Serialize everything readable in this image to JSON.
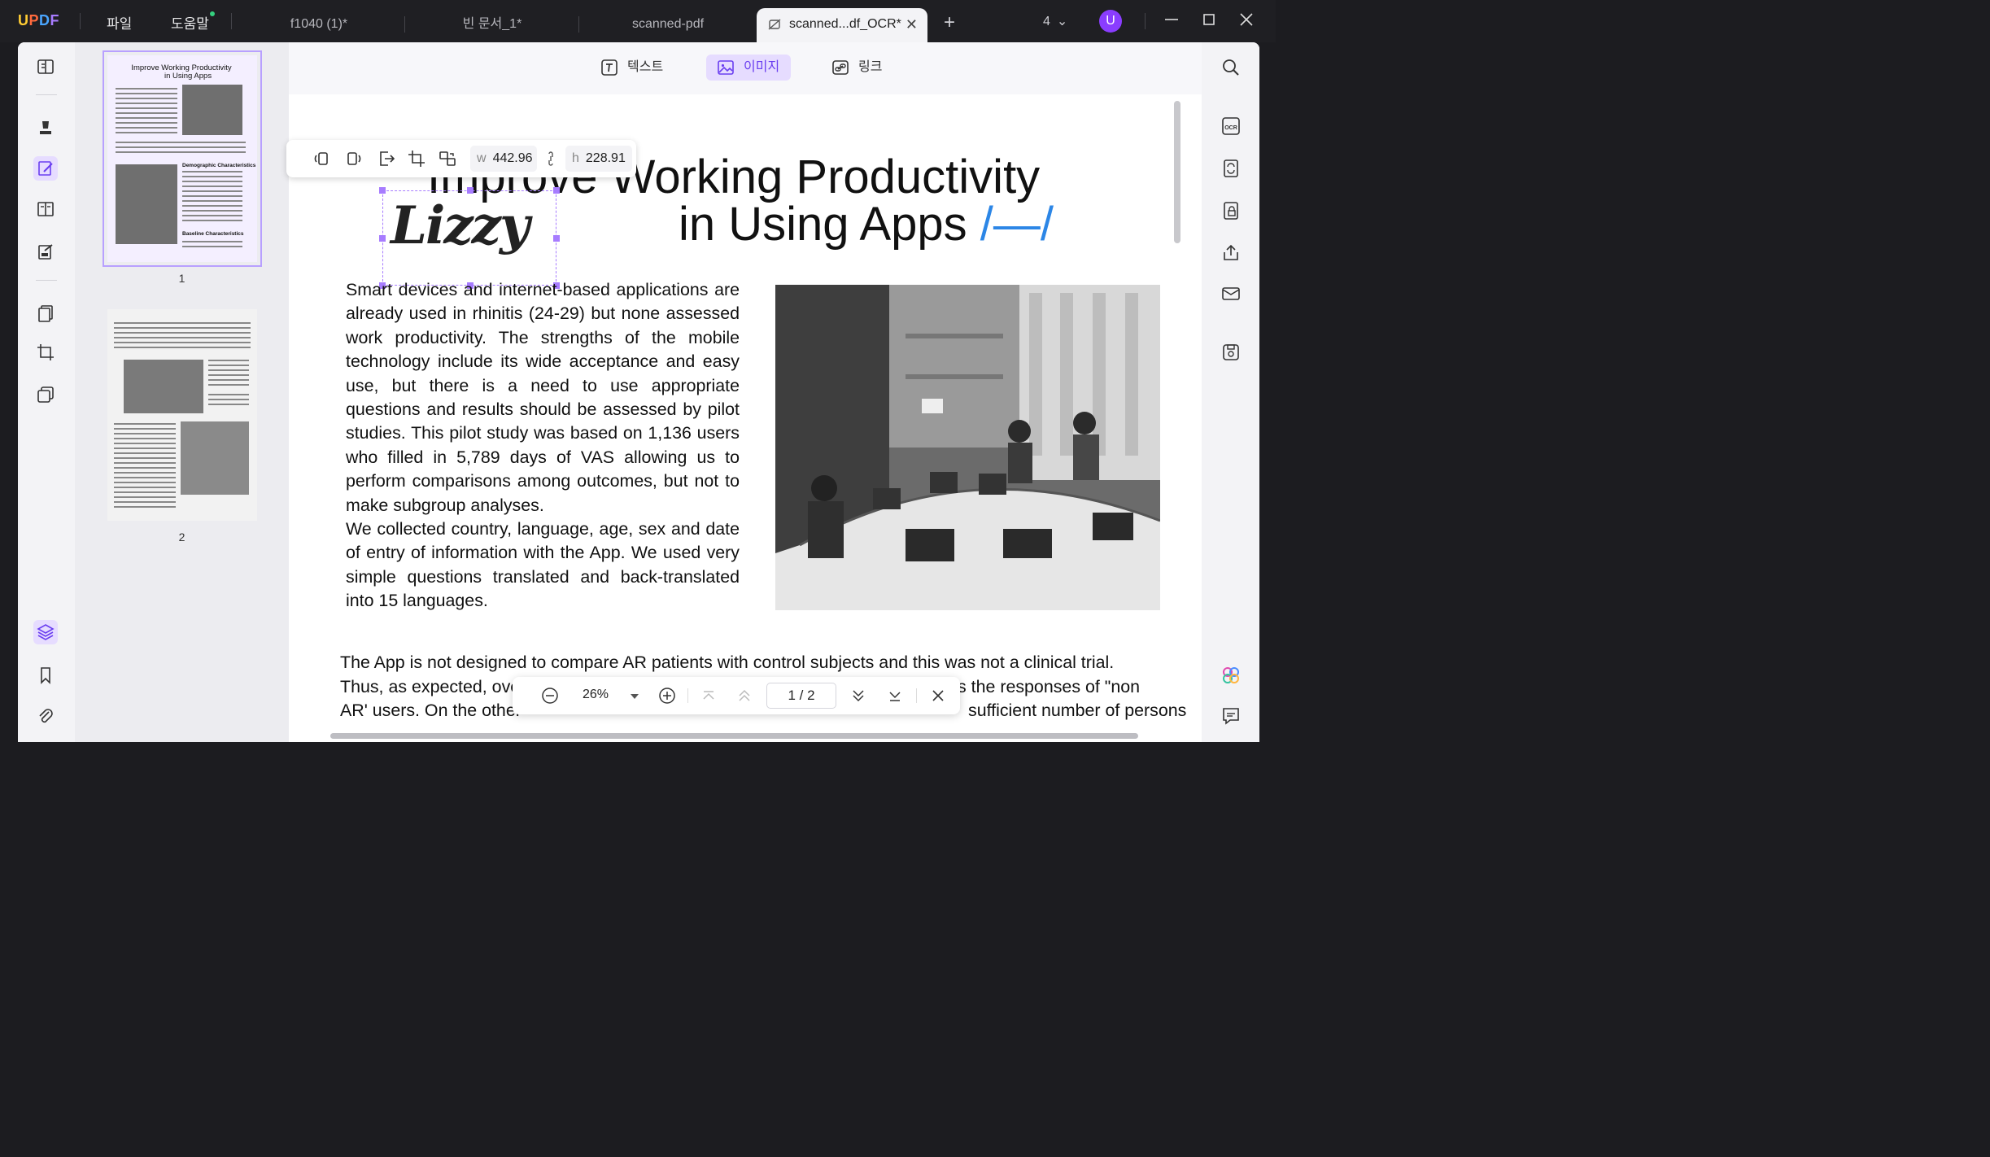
{
  "app": {
    "logo": "UPDF"
  },
  "menu": {
    "file": "파일",
    "help": "도움말"
  },
  "tabs": [
    {
      "label": "f1040 (1)*"
    },
    {
      "label": "빈 문서_1*"
    },
    {
      "label": "scanned-pdf"
    },
    {
      "label": "scanned...df_OCR*"
    }
  ],
  "window": {
    "tab_count": "4",
    "user_initial": "U"
  },
  "modes": {
    "text": "텍스트",
    "image": "이미지",
    "link": "링크"
  },
  "image_toolbar": {
    "w_label": "w",
    "w_value": "442.96",
    "h_label": "h",
    "h_value": "228.91"
  },
  "thumbnails": [
    {
      "label": "1"
    },
    {
      "label": "2"
    }
  ],
  "thumb1": {
    "title": "Improve Working Productivity",
    "subtitle": "in Using Apps",
    "head1": "Demographic Characteristics",
    "head2": "Baseline Characteristics"
  },
  "document": {
    "title_line1": "Improve Working Productivity",
    "title_line2": "in Using Apps",
    "title_accent": "/—/",
    "signature": "Lizzy",
    "para1": "Smart devices and internet-based applications are already used in rhinitis (24-29) but none assessed work productivity. The strengths of the mobile technology include its wide acceptance and easy use, but there is a need to use appropriate questions and results should be assessed by pilot studies. This pilot study was based on 1,136 users who filled in 5,789 days of VAS allowing us to perform comparisons among outcomes, but not to make subgroup analyses.",
    "para2": "We collected country, language, age, sex and date of entry of information with the App. We used very simple questions translated and back-translated into 15 languages.",
    "line_a": "The App is not designed to compare AR patients with control subjects and this was not a clinical trial.",
    "line_b_left": "Thus, as expected, over",
    "line_b_right": "s the responses of \"non",
    "line_c_left": "AR' users. On the other",
    "line_c_right": "sufficient number of persons"
  },
  "navbar": {
    "zoom": "26%",
    "page": "1 / 2"
  },
  "colors": {
    "accent": "#8c5cff",
    "title_accent": "#2c86e6"
  }
}
